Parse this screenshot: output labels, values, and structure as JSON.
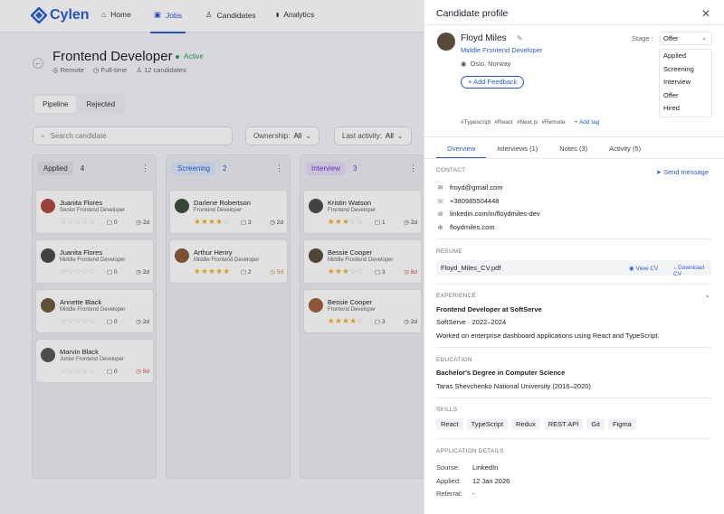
{
  "brand": {
    "name": "Cylen"
  },
  "nav": [
    {
      "label": "Home",
      "icon": "home-icon"
    },
    {
      "label": "Jobs",
      "icon": "briefcase-icon"
    },
    {
      "label": "Candidates",
      "icon": "users-icon"
    },
    {
      "label": "Analytics",
      "icon": "bar-chart-icon"
    }
  ],
  "job": {
    "title": "Frontend Developer",
    "status": "Active",
    "location": "Remote",
    "type": "Full-time",
    "candidates": "12 candidates"
  },
  "view_tabs": [
    "Pipeline",
    "Rejected"
  ],
  "search": {
    "placeholder": "Search candidate"
  },
  "filters": {
    "ownership_label": "Ownership:",
    "ownership_value": "All",
    "activity_label": "Last activity:",
    "activity_value": "All"
  },
  "columns": [
    {
      "stage": "Applied",
      "count": "4",
      "color": "#dfe1e6",
      "text": "#333",
      "cards": [
        {
          "name": "Juanita Flores",
          "role": "Senior Frontend Developer",
          "rating": 0,
          "comments": "0",
          "days": "2d",
          "days_status": "normal",
          "avatar": "#b0473c"
        },
        {
          "name": "Juanita Flores",
          "role": "Middle Frontend Developer",
          "rating": 0,
          "comments": "0",
          "days": "2d",
          "days_status": "normal",
          "avatar": "#4a4a4a"
        },
        {
          "name": "Annette Black",
          "role": "Middle Frontend Developer",
          "rating": 0,
          "comments": "0",
          "days": "2d",
          "days_status": "normal",
          "avatar": "#6b5a3a"
        },
        {
          "name": "Marvin Black",
          "role": "Junior Frontend Developer",
          "rating": 0,
          "comments": "0",
          "days": "9d",
          "days_status": "bad",
          "avatar": "#555"
        }
      ]
    },
    {
      "stage": "Screening",
      "count": "2",
      "color": "#dbe6fb",
      "text": "#2a5bd7",
      "cards": [
        {
          "name": "Darlene Robertson",
          "role": "Frontend Developer",
          "rating": 4,
          "comments": "3",
          "days": "2d",
          "days_status": "normal",
          "avatar": "#3a4c3a"
        },
        {
          "name": "Arthur Henry",
          "role": "Middle Frontend Developer",
          "rating": 5,
          "comments": "2",
          "days": "5d",
          "days_status": "warn",
          "avatar": "#8a5a3a"
        }
      ]
    },
    {
      "stage": "Interview",
      "count": "3",
      "color": "#e7dcf8",
      "text": "#6a3fc4",
      "cards": [
        {
          "name": "Kristin Watson",
          "role": "Frontend Developer",
          "rating": 3,
          "comments": "1",
          "days": "2d",
          "days_status": "normal",
          "avatar": "#4a4a4a"
        },
        {
          "name": "Bessie Cooper",
          "role": "Middle Frontend Developer",
          "rating": 3,
          "comments": "3",
          "days": "8d",
          "days_status": "bad",
          "avatar": "#5a4a3a"
        },
        {
          "name": "Bessie Cooper",
          "role": "Frontend Developer",
          "rating": 4,
          "comments": "3",
          "days": "2d",
          "days_status": "normal",
          "avatar": "#a0603a"
        }
      ]
    }
  ],
  "profile": {
    "header": "Candidate profile",
    "name": "Floyd Miles",
    "role": "Middle Frontend Developer",
    "location": "Oslo, Norway",
    "add_feedback": "Add Feedback",
    "stage_label": "Stage :",
    "stage_value": "Offer",
    "stage_options": [
      "Applied",
      "Screening",
      "Interview",
      "Offer",
      "Hired"
    ],
    "tags": [
      "#Typescript",
      "#React",
      "#Next.js",
      "#Remote"
    ],
    "add_tag": "Add tag",
    "tabs": [
      "Overview",
      "Interviews (1)",
      "Notes (3)",
      "Activity (5)"
    ],
    "contact_label": "CONTACT",
    "send_message": "Send message",
    "contacts": [
      {
        "icon": "mail-icon",
        "value": "froyd@gmail.com"
      },
      {
        "icon": "phone-icon",
        "value": "+380985504448"
      },
      {
        "icon": "linkedin-icon",
        "value": "linkedin.com/in/floydmiles-dev"
      },
      {
        "icon": "globe-icon",
        "value": "floydmiles.com"
      }
    ],
    "resume_label": "RESUME",
    "resume_file": "Floyd_Miles_CV.pdf",
    "view_cv": "View CV",
    "download_cv": "Download CV",
    "experience_label": "EXPERIENCE",
    "exp_title": "Frontend Developer at SoftServe",
    "exp_meta": "SoftServe · 2022–2024",
    "exp_desc": "Worked on enterprise dashboard applications using React and TypeScript.",
    "education_label": "EDUCATION",
    "edu_title": "Bachelor's Degree in Computer Science",
    "edu_meta": "Taras Shevchenko National University (2016–2020)",
    "skills_label": "SKILLS",
    "skills": [
      "React",
      "TypeScript",
      "Redux",
      "REST API",
      "Git",
      "Figma"
    ],
    "app_label": "APPLICATION DETAILS",
    "app_details": [
      {
        "k": "Sourse:",
        "v": "LinkedIn"
      },
      {
        "k": "Applied:",
        "v": "12 Jan 2026"
      },
      {
        "k": "Referral:",
        "v": "-"
      }
    ]
  }
}
